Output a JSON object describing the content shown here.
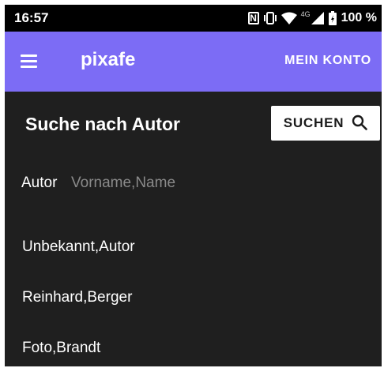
{
  "status_bar": {
    "time": "16:57",
    "network": "4G",
    "battery": "100 %",
    "icons": [
      "nfc-icon",
      "vibrate-icon",
      "wifi-icon",
      "signal-icon",
      "battery-icon"
    ]
  },
  "app_bar": {
    "title": "pixafe",
    "account_label": "MEIN KONTO",
    "color": "#7c6cf5",
    "menu_icon": "hamburger-menu-icon"
  },
  "search": {
    "heading": "Suche nach Autor",
    "button_label": "SUCHEN",
    "button_icon": "search-icon",
    "field_label": "Autor",
    "placeholder": "Vorname,Name",
    "value": ""
  },
  "results": [
    {
      "name": "Unbekannt,Autor"
    },
    {
      "name": "Reinhard,Berger"
    },
    {
      "name": "Foto,Brandt"
    }
  ],
  "colors": {
    "background": "#1f1f1f",
    "status_bar": "#000000",
    "text": "#ffffff",
    "placeholder": "#8a8a8a"
  }
}
